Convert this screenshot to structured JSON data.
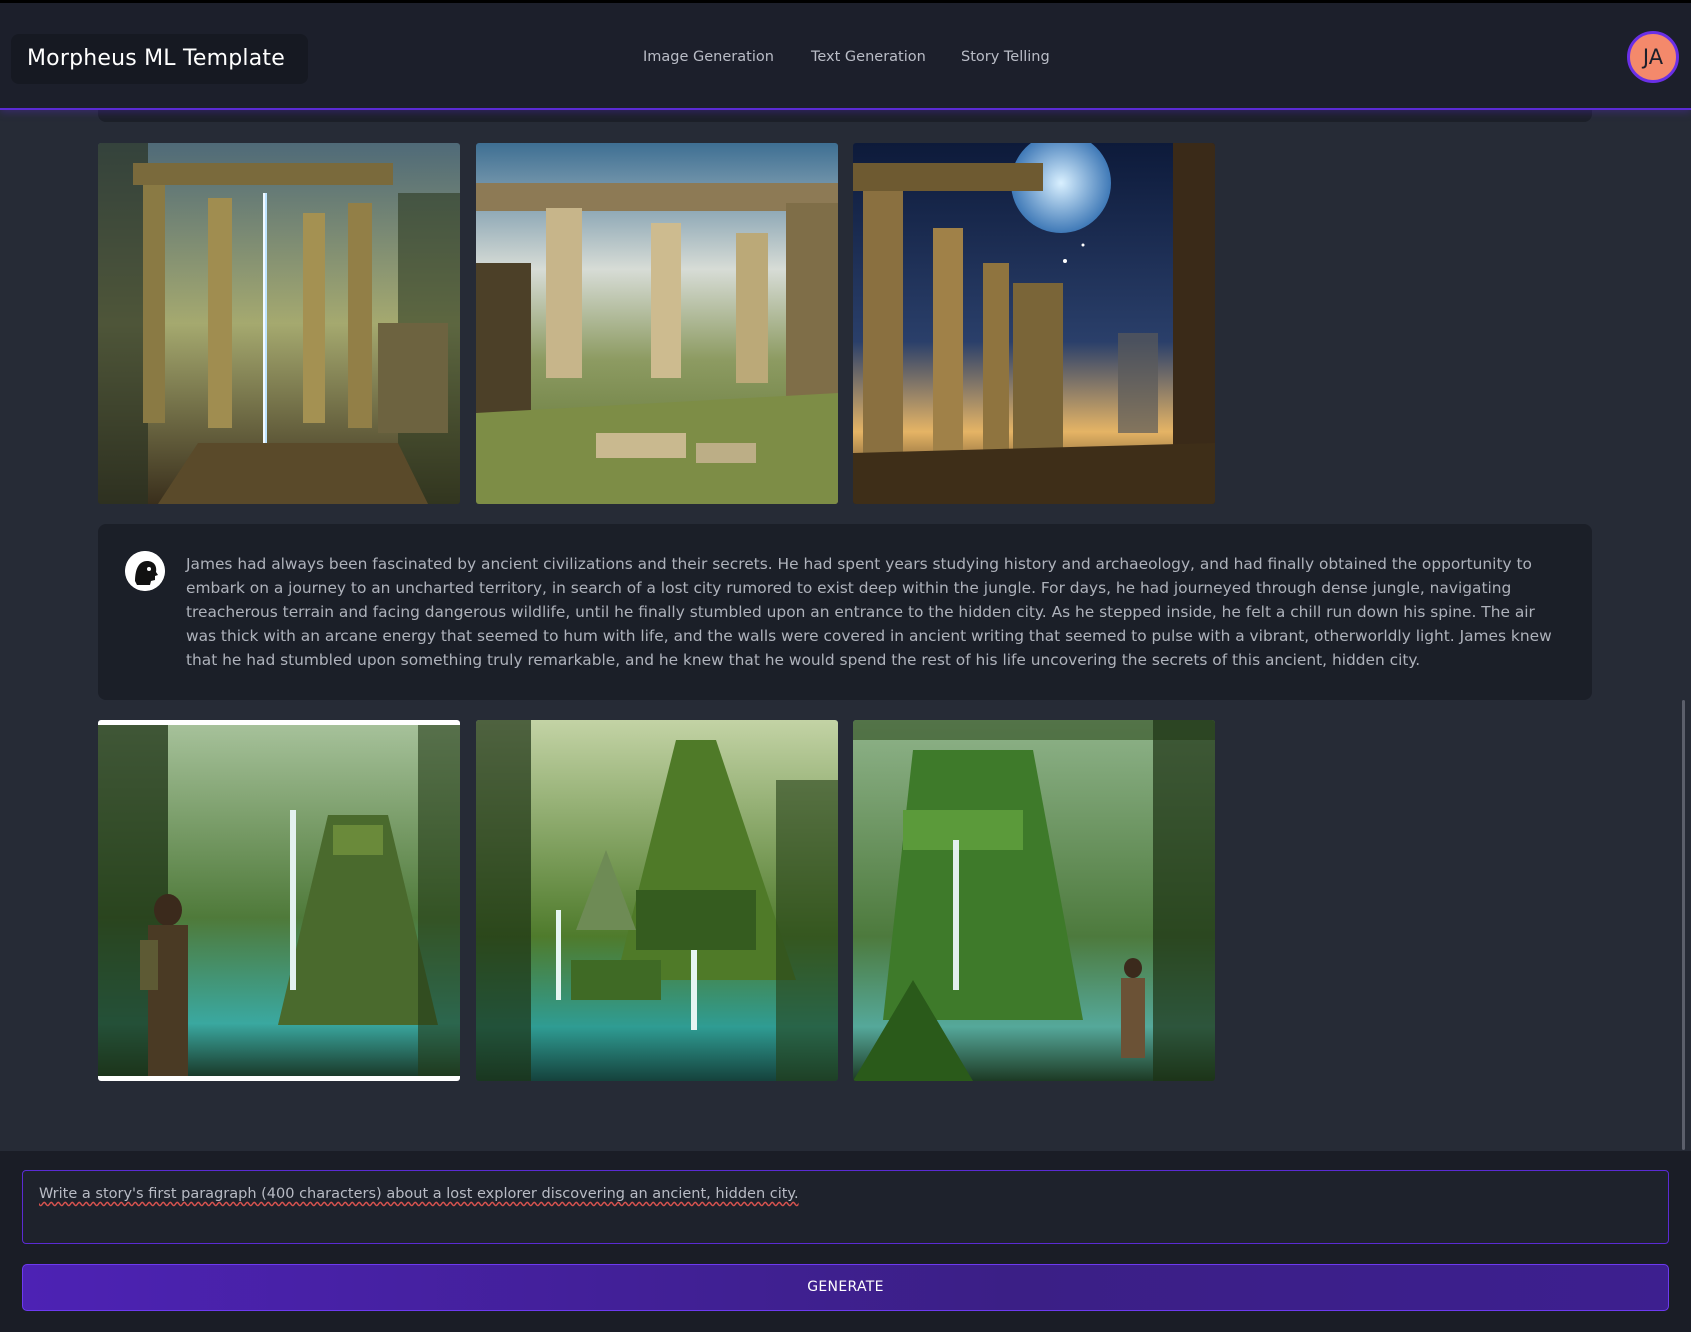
{
  "header": {
    "brand": "Morpheus ML Template",
    "nav": [
      "Image Generation",
      "Text Generation",
      "Story Telling"
    ],
    "avatar_initials": "JA"
  },
  "story": {
    "text": "James had always been fascinated by ancient civilizations and their secrets. He had spent years studying history and archaeology, and had finally obtained the opportunity to embark on a journey to an uncharted territory, in search of a lost city rumored to exist deep within the jungle. For days, he had journeyed through dense jungle, navigating treacherous terrain and facing dangerous wildlife, until he finally stumbled upon an entrance to the hidden city. As he stepped inside, he felt a chill run down his spine. The air was thick with an arcane energy that seemed to hum with life, and the walls were covered in ancient writing that seemed to pulse with a vibrant, otherworldly light. James knew that he had stumbled upon something truly remarkable, and he knew that he would spend the rest of his life uncovering the secrets of this ancient, hidden city."
  },
  "image_rows": [
    {
      "images": [
        "ruins-temple-waterfall-image",
        "ruins-colonnade-image",
        "ruins-moon-night-image"
      ]
    },
    {
      "images": [
        "jungle-pyramid-explorer-image",
        "jungle-temple-waterfall-image",
        "jungle-ruins-explorer-image"
      ],
      "selected_index": 0
    }
  ],
  "prompt": {
    "value": "Write a story's first paragraph (400 characters) about a lost explorer discovering an ancient, hidden city."
  },
  "generate_label": "GENERATE",
  "colors": {
    "accent": "#5b2bd4",
    "background": "#262b36",
    "header_bg": "#1c1f2b",
    "avatar": "#f4896b"
  }
}
